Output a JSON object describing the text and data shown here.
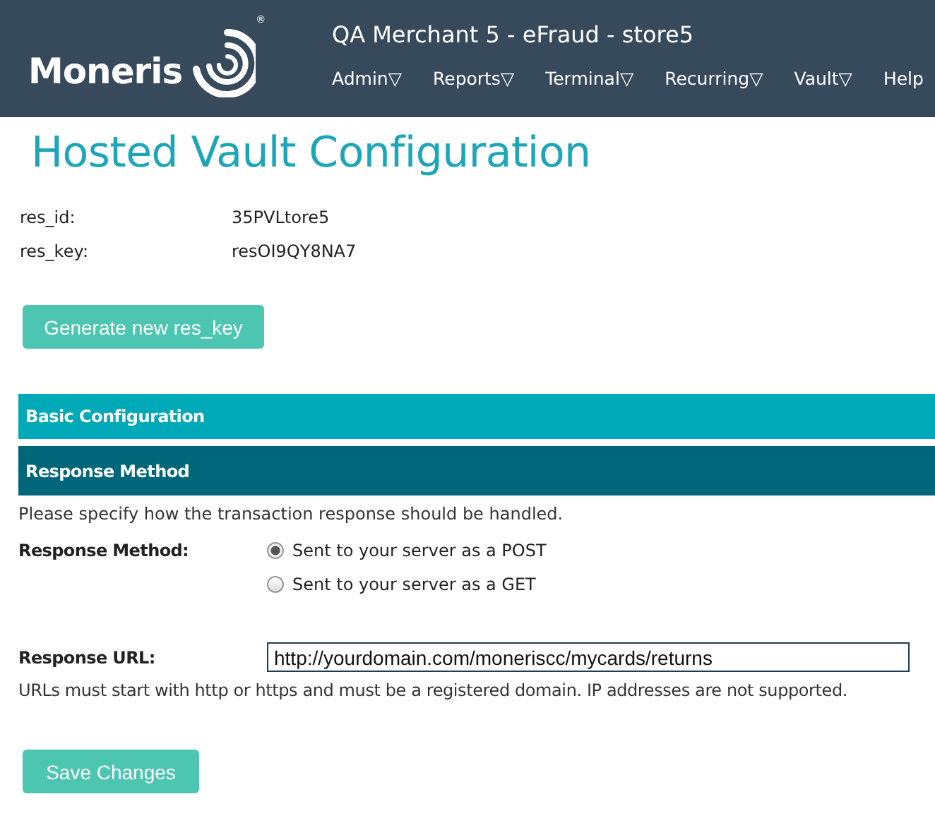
{
  "header": {
    "logo": "Moneris",
    "registered": "®",
    "merchant": "QA Merchant 5 - eFraud - store5",
    "nav": [
      {
        "label": "Admin",
        "caret": "▽"
      },
      {
        "label": "Reports",
        "caret": "▽"
      },
      {
        "label": "Terminal",
        "caret": "▽"
      },
      {
        "label": "Recurring",
        "caret": "▽"
      },
      {
        "label": "Vault",
        "caret": "▽"
      },
      {
        "label": "Help"
      }
    ]
  },
  "title": "Hosted Vault Configuration",
  "fields": [
    {
      "label": "res_id:",
      "value": "35PVLtore5"
    },
    {
      "label": "res_key:",
      "value": "resOI9QY8NA7"
    }
  ],
  "generate_button": "Generate new res_key",
  "sections": [
    {
      "title": "Basic Configuration",
      "expanded": false
    },
    {
      "title": "Response Method",
      "expanded": true
    }
  ],
  "instruction": "Please specify how the transaction response should be handled.",
  "response_method": {
    "label": "Response Method:",
    "options": [
      {
        "label": "Sent to your server as a POST",
        "selected": true
      },
      {
        "label": "Sent to your server as a GET",
        "selected": false
      }
    ]
  },
  "response_url": {
    "label": "Response URL:",
    "value": "http://yourdomain.com/moneriscc/mycards/returns"
  },
  "hint": "URLs must start with http or https and must be a registered domain. IP addresses are not supported.",
  "save_button": "Save Changes"
}
